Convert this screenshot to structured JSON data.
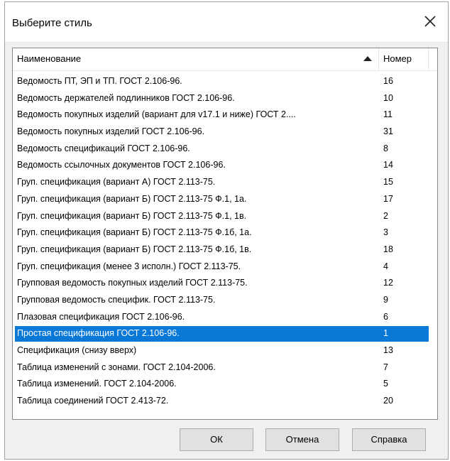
{
  "window": {
    "title": "Выберите стиль"
  },
  "table": {
    "columns": [
      "Наименование",
      "Номер"
    ],
    "rows": [
      {
        "name": "Ведомость ПТ, ЭП и ТП. ГОСТ 2.106-96.",
        "number": "16"
      },
      {
        "name": "Ведомость держателей подлинников ГОСТ 2.106-96.",
        "number": "10"
      },
      {
        "name": "Ведомость покупных изделий (вариант для v17.1 и ниже) ГОСТ 2....",
        "number": "11"
      },
      {
        "name": "Ведомость покупных изделий ГОСТ 2.106-96.",
        "number": "31"
      },
      {
        "name": "Ведомость спецификаций ГОСТ 2.106-96.",
        "number": "8"
      },
      {
        "name": "Ведомость ссылочных документов ГОСТ 2.106-96.",
        "number": "14"
      },
      {
        "name": "Груп. спецификация (вариант А) ГОСТ 2.113-75.",
        "number": "15"
      },
      {
        "name": "Груп. спецификация (вариант Б) ГОСТ 2.113-75 Ф.1, 1а.",
        "number": "17"
      },
      {
        "name": "Груп. спецификация (вариант Б) ГОСТ 2.113-75 Ф.1, 1в.",
        "number": "2"
      },
      {
        "name": "Груп. спецификация (вариант Б) ГОСТ 2.113-75 Ф.1б, 1а.",
        "number": "3"
      },
      {
        "name": "Груп. спецификация (вариант Б) ГОСТ 2.113-75 Ф.1б, 1в.",
        "number": "18"
      },
      {
        "name": "Груп. спецификация (менее 3 исполн.) ГОСТ 2.113-75.",
        "number": "4"
      },
      {
        "name": "Групповая ведомость покупных изделий ГОСТ 2.113-75.",
        "number": "12"
      },
      {
        "name": "Групповая ведомость специфик. ГОСТ 2.113-75.",
        "number": "9"
      },
      {
        "name": "Плазовая спецификация ГОСТ 2.106-96.",
        "number": "6"
      },
      {
        "name": "Простая спецификация ГОСТ 2.106-96.",
        "number": "1"
      },
      {
        "name": "Спецификация (снизу вверх)",
        "number": "13"
      },
      {
        "name": "Таблица изменений с зонами. ГОСТ 2.104-2006.",
        "number": "7"
      },
      {
        "name": "Таблица изменений. ГОСТ 2.104-2006.",
        "number": "5"
      },
      {
        "name": "Таблица соединений ГОСТ 2.413-72.",
        "number": "20"
      }
    ],
    "selected_row": 15,
    "sort": "ascending"
  },
  "buttons": {
    "ok": "ОК",
    "cancel": "Отмена",
    "help": "Справка"
  },
  "colors": {
    "selection": "#0a78d7"
  },
  "icons": {
    "close": "close-icon",
    "sort": "sort-ascending-icon"
  }
}
